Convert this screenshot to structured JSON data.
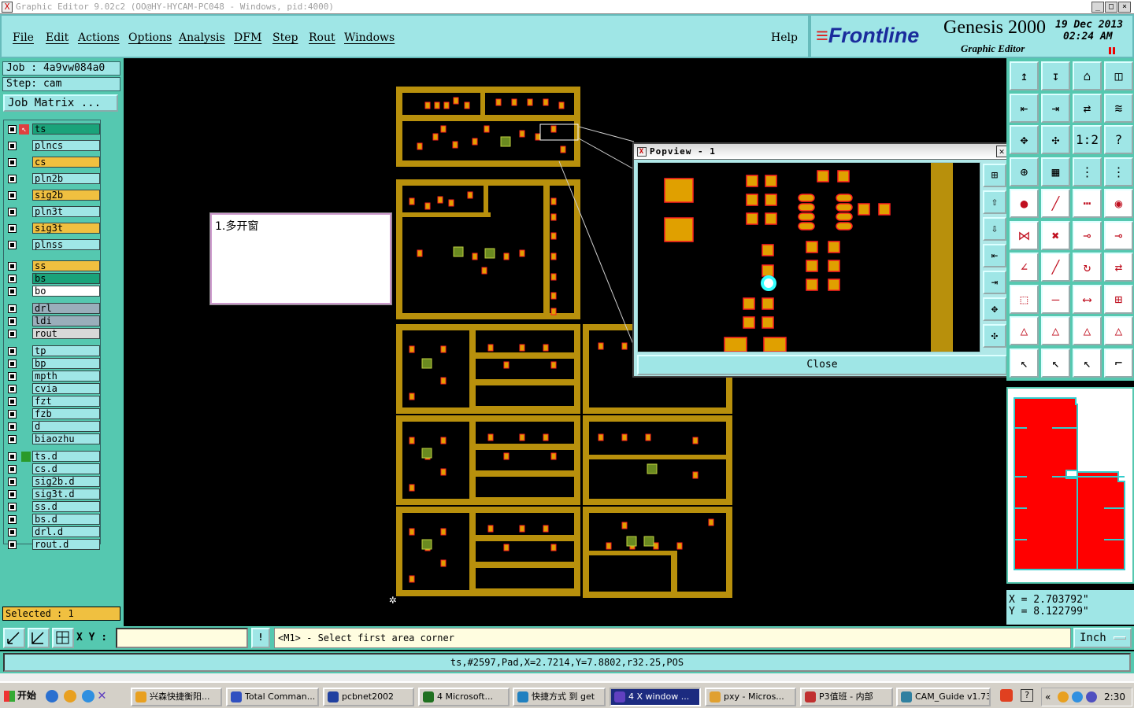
{
  "window": {
    "title": "Graphic Editor 9.02c2  (OO@HY-HYCAM-PC048 - Windows, pid:4000)",
    "controls": [
      "_",
      "□",
      "×"
    ]
  },
  "menu": {
    "items": [
      "File",
      "Edit",
      "Actions",
      "Options",
      "Analysis",
      "DFM",
      "Step",
      "Rout",
      "Windows"
    ],
    "help": "Help"
  },
  "brand": {
    "logo": "Frontline",
    "product": "Genesis 2000",
    "subtitle": "Graphic Editor",
    "date": "19  Dec  2013",
    "time": "02:24  AM"
  },
  "job": {
    "job_label": "Job : 4a9vw084a0",
    "step_label": "Step: cam",
    "matrix_button": "Job Matrix ..."
  },
  "layers": [
    {
      "name": "ts",
      "color": "#1aa37a",
      "active": true
    },
    {
      "name": "plncs",
      "color": "#9fe6e6"
    },
    {
      "name": "cs",
      "color": "#f0c040"
    },
    {
      "name": "pln2b",
      "color": "#9fe6e6"
    },
    {
      "name": "sig2b",
      "color": "#f0c040"
    },
    {
      "name": "pln3t",
      "color": "#9fe6e6"
    },
    {
      "name": "sig3t",
      "color": "#f0c040"
    },
    {
      "name": "plnss",
      "color": "#9fe6e6"
    },
    {
      "name": "ss",
      "color": "#f0c040"
    },
    {
      "name": "bs",
      "color": "#1aa37a"
    },
    {
      "name": "bo",
      "color": "#ffffff"
    },
    {
      "name": "drl",
      "color": "#9aaebb"
    },
    {
      "name": "ldi",
      "color": "#9aaebb"
    },
    {
      "name": "rout",
      "color": "#d8d8d8"
    },
    {
      "name": "tp",
      "color": "#9fe6e6"
    },
    {
      "name": "bp",
      "color": "#9fe6e6"
    },
    {
      "name": "mpth",
      "color": "#9fe6e6"
    },
    {
      "name": "cvia",
      "color": "#9fe6e6"
    },
    {
      "name": "fzt",
      "color": "#9fe6e6"
    },
    {
      "name": "fzb",
      "color": "#9fe6e6"
    },
    {
      "name": "d",
      "color": "#9fe6e6"
    },
    {
      "name": "biaozhu",
      "color": "#9fe6e6"
    },
    {
      "name": "ts.d",
      "color": "#9fe6e6"
    },
    {
      "name": "cs.d",
      "color": "#9fe6e6"
    },
    {
      "name": "sig2b.d",
      "color": "#9fe6e6"
    },
    {
      "name": "sig3t.d",
      "color": "#9fe6e6"
    },
    {
      "name": "ss.d",
      "color": "#9fe6e6"
    },
    {
      "name": "bs.d",
      "color": "#9fe6e6"
    },
    {
      "name": "drl.d",
      "color": "#9fe6e6"
    },
    {
      "name": "rout.d",
      "color": "#9fe6e6"
    }
  ],
  "selected": "Selected : 1",
  "annotation": "1.多开窗",
  "popview": {
    "title": "Popview - 1",
    "close_label": "Close"
  },
  "coords": {
    "x": "X = 2.703792\"",
    "y": "Y = 8.122799\""
  },
  "bottom": {
    "xy_label": "X Y :",
    "xy_value": "",
    "message": "<M1> - Select first area corner",
    "unit": "Inch"
  },
  "status": "ts,#2597,Pad,X=2.7214,Y=7.8802,r32.25,POS",
  "taskbar": {
    "start": "开始",
    "tasks": [
      {
        "label": "兴森快捷衡阳...",
        "color": "#e8a020"
      },
      {
        "label": "Total Comman...",
        "color": "#3050c0"
      },
      {
        "label": "pcbnet2002",
        "color": "#2040a0"
      },
      {
        "label": "4 Microsoft...",
        "color": "#207020"
      },
      {
        "label": "快捷方式 到 get",
        "color": "#2080c0"
      },
      {
        "label": "4 X window ...",
        "color": "#6040c0",
        "active": true
      },
      {
        "label": "pxy - Micros...",
        "color": "#e0a030"
      },
      {
        "label": "P3值班 - 内部",
        "color": "#c03030"
      },
      {
        "label": "CAM_Guide v1.73",
        "color": "#3080a0"
      }
    ],
    "clock": "2:30"
  },
  "colors": {
    "panel": "#9fe6e6",
    "panel_dark": "#55c8b0",
    "copper": "#b8900c",
    "pad": "#e0a000",
    "pad_outline": "#ff2020",
    "minimap_fill": "#ff0000"
  }
}
